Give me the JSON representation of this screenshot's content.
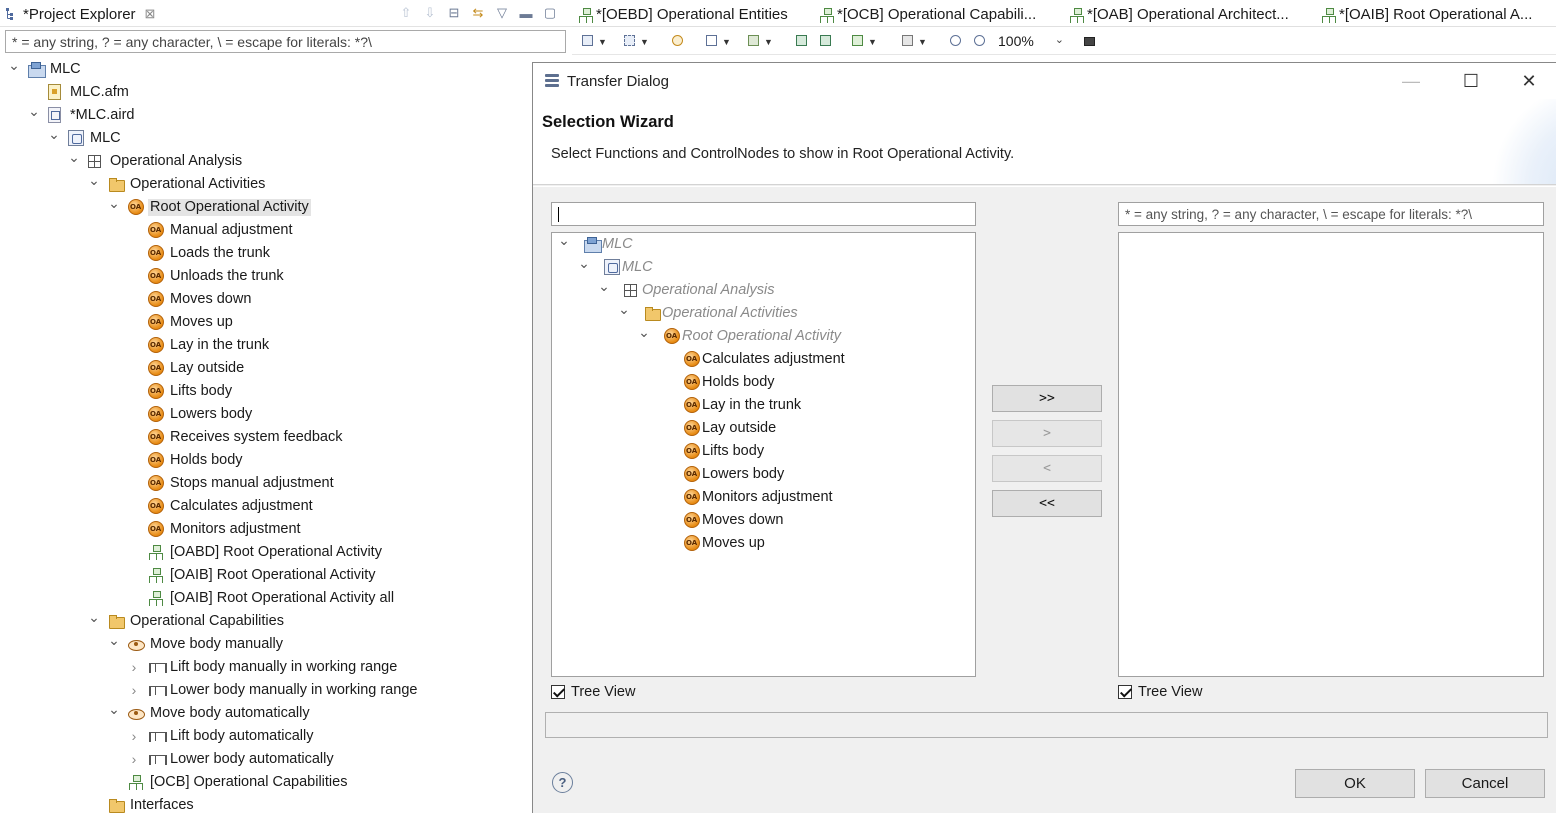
{
  "project_explorer": {
    "tab_label": "*Project Explorer",
    "filter_text": "* = any string, ? = any character, \\ = escape for literals: *?\\",
    "tree": [
      {
        "label": "MLC",
        "depth": 0,
        "arrow": "open",
        "icon": "project-folder-icon"
      },
      {
        "label": "MLC.afm",
        "depth": 1,
        "arrow": "none",
        "icon": "afm-file-icon"
      },
      {
        "label": "*MLC.aird",
        "depth": 1,
        "arrow": "open",
        "icon": "aird-file-icon"
      },
      {
        "label": "MLC",
        "depth": 2,
        "arrow": "open",
        "icon": "model-icon"
      },
      {
        "label": "Operational Analysis",
        "depth": 3,
        "arrow": "open",
        "icon": "grid-icon"
      },
      {
        "label": "Operational Activities",
        "depth": 4,
        "arrow": "open",
        "icon": "folder-icon"
      },
      {
        "label": "Root Operational Activity",
        "depth": 5,
        "arrow": "open",
        "icon": "operational-activity-icon",
        "selected": true
      },
      {
        "label": "Manual adjustment",
        "depth": 6,
        "arrow": "none",
        "icon": "operational-activity-icon"
      },
      {
        "label": "Loads the trunk",
        "depth": 6,
        "arrow": "none",
        "icon": "operational-activity-icon"
      },
      {
        "label": "Unloads the trunk",
        "depth": 6,
        "arrow": "none",
        "icon": "operational-activity-icon"
      },
      {
        "label": "Moves down",
        "depth": 6,
        "arrow": "none",
        "icon": "operational-activity-icon"
      },
      {
        "label": "Moves up",
        "depth": 6,
        "arrow": "none",
        "icon": "operational-activity-icon"
      },
      {
        "label": "Lay in the trunk",
        "depth": 6,
        "arrow": "none",
        "icon": "operational-activity-icon"
      },
      {
        "label": "Lay outside",
        "depth": 6,
        "arrow": "none",
        "icon": "operational-activity-icon"
      },
      {
        "label": "Lifts body",
        "depth": 6,
        "arrow": "none",
        "icon": "operational-activity-icon"
      },
      {
        "label": "Lowers body",
        "depth": 6,
        "arrow": "none",
        "icon": "operational-activity-icon"
      },
      {
        "label": "Receives system feedback",
        "depth": 6,
        "arrow": "none",
        "icon": "operational-activity-icon"
      },
      {
        "label": "Holds body",
        "depth": 6,
        "arrow": "none",
        "icon": "operational-activity-icon"
      },
      {
        "label": "Stops manual adjustment",
        "depth": 6,
        "arrow": "none",
        "icon": "operational-activity-icon"
      },
      {
        "label": "Calculates adjustment",
        "depth": 6,
        "arrow": "none",
        "icon": "operational-activity-icon"
      },
      {
        "label": "Monitors adjustment",
        "depth": 6,
        "arrow": "none",
        "icon": "operational-activity-icon"
      },
      {
        "label": "[OABD] Root Operational Activity",
        "depth": 6,
        "arrow": "none",
        "icon": "diagram-icon"
      },
      {
        "label": "[OAIB] Root Operational Activity",
        "depth": 6,
        "arrow": "none",
        "icon": "diagram-icon"
      },
      {
        "label": "[OAIB] Root Operational Activity all",
        "depth": 6,
        "arrow": "none",
        "icon": "diagram-icon"
      },
      {
        "label": "Operational Capabilities",
        "depth": 4,
        "arrow": "open",
        "icon": "folder-icon"
      },
      {
        "label": "Move body manually",
        "depth": 5,
        "arrow": "open",
        "icon": "capability-icon"
      },
      {
        "label": "Lift body manually in working range",
        "depth": 6,
        "arrow": "closed",
        "icon": "functional-chain-icon"
      },
      {
        "label": "Lower body manually in working range",
        "depth": 6,
        "arrow": "closed",
        "icon": "functional-chain-icon"
      },
      {
        "label": "Move body automatically",
        "depth": 5,
        "arrow": "open",
        "icon": "capability-icon"
      },
      {
        "label": "Lift body automatically",
        "depth": 6,
        "arrow": "closed",
        "icon": "functional-chain-icon"
      },
      {
        "label": "Lower body automatically",
        "depth": 6,
        "arrow": "closed",
        "icon": "functional-chain-icon"
      },
      {
        "label": "[OCB] Operational Capabilities",
        "depth": 5,
        "arrow": "none",
        "icon": "diagram-icon"
      },
      {
        "label": "Interfaces",
        "depth": 4,
        "arrow": "none",
        "icon": "folder-icon"
      }
    ]
  },
  "editor": {
    "tabs": [
      {
        "label": "*[OEBD] Operational Entities"
      },
      {
        "label": "*[OCB] Operational Capabili..."
      },
      {
        "label": "*[OAB] Operational Architect..."
      },
      {
        "label": "*[OAIB] Root Operational A..."
      }
    ],
    "zoom_value": "100%"
  },
  "dialog": {
    "title": "Transfer Dialog",
    "heading": "Selection Wizard",
    "description": "Select Functions and ControlNodes to show in Root Operational Activity.",
    "left_filter_value": "",
    "right_filter_text": "* = any string, ? = any character, \\ = escape for literals: *?\\",
    "left_tree": [
      {
        "label": "MLC",
        "depth": 0,
        "arrow": "open",
        "icon": "project-folder-icon",
        "ghost": true
      },
      {
        "label": "MLC",
        "depth": 1,
        "arrow": "open",
        "icon": "model-icon",
        "ghost": true
      },
      {
        "label": "Operational Analysis",
        "depth": 2,
        "arrow": "open",
        "icon": "grid-icon",
        "ghost": true
      },
      {
        "label": "Operational Activities",
        "depth": 3,
        "arrow": "open",
        "icon": "folder-icon",
        "ghost": true
      },
      {
        "label": "Root Operational Activity",
        "depth": 4,
        "arrow": "open",
        "icon": "operational-activity-icon",
        "ghost": true
      },
      {
        "label": "Calculates adjustment",
        "depth": 5,
        "arrow": "none",
        "icon": "operational-activity-icon"
      },
      {
        "label": "Holds body",
        "depth": 5,
        "arrow": "none",
        "icon": "operational-activity-icon"
      },
      {
        "label": "Lay in the trunk",
        "depth": 5,
        "arrow": "none",
        "icon": "operational-activity-icon"
      },
      {
        "label": "Lay outside",
        "depth": 5,
        "arrow": "none",
        "icon": "operational-activity-icon"
      },
      {
        "label": "Lifts body",
        "depth": 5,
        "arrow": "none",
        "icon": "operational-activity-icon"
      },
      {
        "label": "Lowers body",
        "depth": 5,
        "arrow": "none",
        "icon": "operational-activity-icon"
      },
      {
        "label": "Monitors adjustment",
        "depth": 5,
        "arrow": "none",
        "icon": "operational-activity-icon"
      },
      {
        "label": "Moves down",
        "depth": 5,
        "arrow": "none",
        "icon": "operational-activity-icon"
      },
      {
        "label": "Moves up",
        "depth": 5,
        "arrow": "none",
        "icon": "operational-activity-icon"
      }
    ],
    "buttons": {
      "add_all": ">>",
      "add": ">",
      "remove": "<",
      "remove_all": "<<",
      "ok": "OK",
      "cancel": "Cancel"
    },
    "left_tree_view_label": "Tree View",
    "right_tree_view_label": "Tree View",
    "left_tree_view_checked": true,
    "right_tree_view_checked": true
  }
}
